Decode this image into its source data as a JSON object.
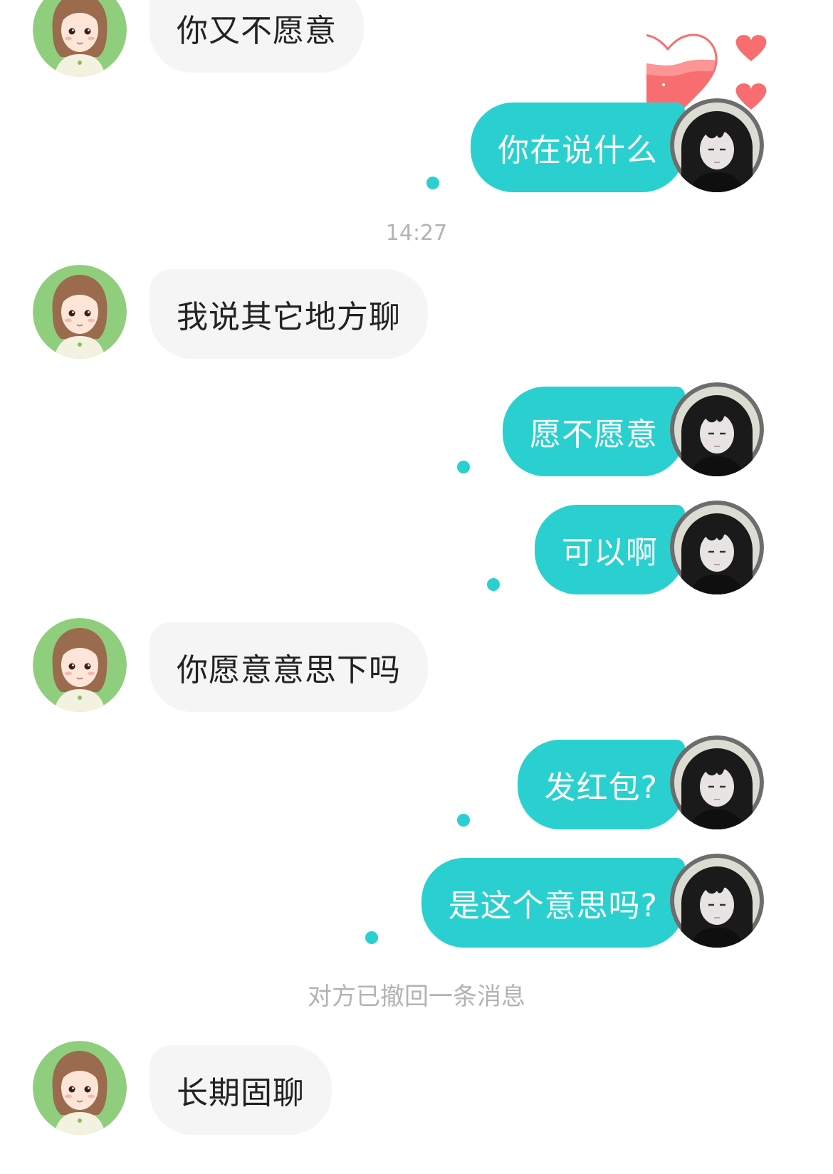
{
  "messages": [
    {
      "side": "left",
      "text": "你又不愿意"
    },
    {
      "side": "right",
      "text": "你在说什么",
      "read_dot": true
    },
    {
      "type": "timestamp",
      "text": "14:27"
    },
    {
      "side": "left",
      "text": "我说其它地方聊"
    },
    {
      "side": "right",
      "text": "愿不愿意",
      "read_dot": true
    },
    {
      "side": "right",
      "text": "可以啊",
      "read_dot": true
    },
    {
      "side": "left",
      "text": "你愿意意思下吗"
    },
    {
      "side": "right",
      "text": "发红包?",
      "read_dot": true
    },
    {
      "side": "right",
      "text": "是这个意思吗?",
      "read_dot": true
    },
    {
      "type": "system",
      "text": "对方已撤回一条消息"
    },
    {
      "side": "left",
      "text": "长期固聊"
    }
  ],
  "colors": {
    "accent": "#2ad0cf",
    "left_bubble_bg": "#f5f5f5",
    "left_text": "#222222",
    "system_text": "#b3b3b3",
    "heart": "#f86e70",
    "female_avatar_bg": "#8fce7c"
  },
  "icons": {
    "intimacy_meter": "heart-meter-icon",
    "floating_hearts": "heart-icon",
    "contact_avatar": "female-avatar",
    "self_avatar": "male-avatar"
  }
}
